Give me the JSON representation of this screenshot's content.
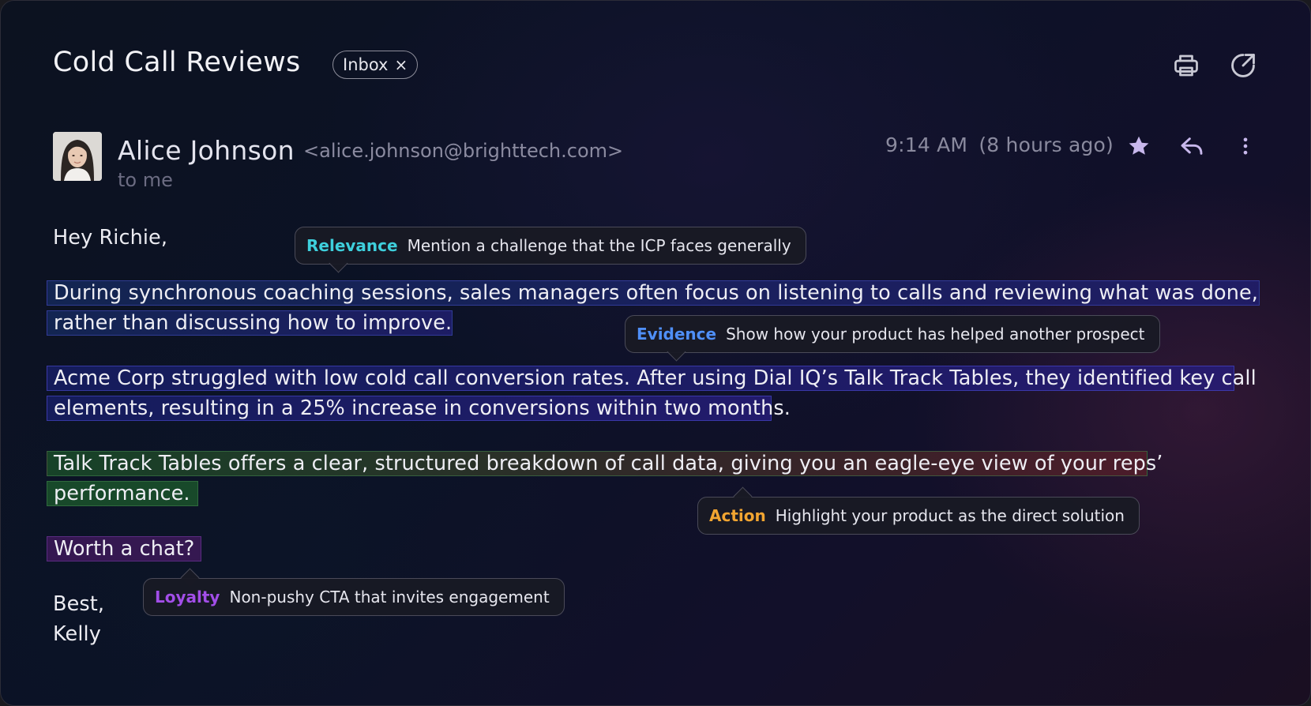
{
  "header": {
    "title": "Cold Call Reviews",
    "label_chip": "Inbox",
    "label_chip_remove": "×",
    "print_icon": "printer-icon",
    "open_external_icon": "open-in-new-window-icon"
  },
  "message": {
    "sender_name": "Alice Johnson",
    "sender_email": "<alice.johnson@brighttech.com>",
    "recipient": "to me",
    "time": "9:14 AM",
    "relative_time": "(8 hours ago)",
    "star_icon": "star-icon",
    "reply_icon": "reply-icon",
    "more_icon": "more-vertical-icon",
    "greeting": "Hey Richie,",
    "para1_line1": "During synchronous coaching sessions, sales managers often focus on listening to calls and reviewing what was done,",
    "para1_line2": "rather than discussing how to improve.",
    "para2_line1": "Acme Corp struggled with low cold call conversion rates. After using Dial IQ’s Talk Track Tables, they identified key call",
    "para2_line2": "elements, resulting in a 25% increase in conversions within two months.",
    "para3_line1": "Talk Track Tables offers a clear, structured breakdown of call data, giving you an eagle-eye view of your reps’",
    "para3_line2": "performance.",
    "cta": "Worth a chat?",
    "signoff": "Best,",
    "signature": "Kelly"
  },
  "annotations": [
    {
      "tag": "Relevance",
      "text": "Mention a challenge that the ICP faces generally",
      "color": "#3ecfdc"
    },
    {
      "tag": "Evidence",
      "text": "Show how your product has helped another prospect",
      "color": "#4f8ff7"
    },
    {
      "tag": "Action",
      "text": "Highlight your product as the direct solution",
      "color": "#f2a531"
    },
    {
      "tag": "Loyalty",
      "text": "Non-pushy CTA that invites engagement",
      "color": "#a24ee8"
    }
  ]
}
